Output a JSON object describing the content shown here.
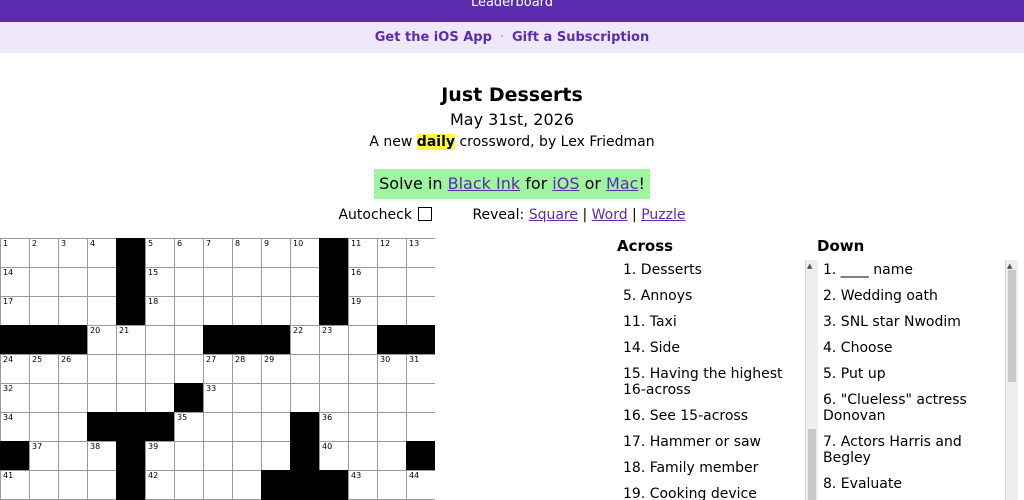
{
  "header": {
    "leaderboard": "Leaderboard"
  },
  "promo": {
    "ios_app": "Get the iOS App",
    "separator": "·",
    "gift": "Gift a Subscription"
  },
  "puzzle": {
    "title": "Just Desserts",
    "date": "May 31st, 2026",
    "byline_prefix": "A new ",
    "byline_highlight": "daily",
    "byline_suffix": " crossword, by Lex Friedman"
  },
  "solve": {
    "prefix": "Solve in ",
    "black_ink": "Black Ink",
    "for": " for ",
    "ios": "iOS",
    "or": " or ",
    "mac": "Mac",
    "suffix": "!"
  },
  "controls": {
    "autocheck": "Autocheck",
    "reveal": "Reveal:",
    "square": "Square",
    "word": "Word",
    "puzzle": "Puzzle",
    "sep": "|"
  },
  "grid": {
    "rows": [
      [
        "1",
        "2",
        "3",
        "4",
        "#",
        "5",
        "6",
        "7",
        "8",
        "9",
        "10",
        "#",
        "11",
        "12",
        "13"
      ],
      [
        "14",
        "",
        "",
        "",
        "#",
        "15",
        "",
        "",
        "",
        "",
        "",
        "#",
        "16",
        "",
        ""
      ],
      [
        "17",
        "",
        "",
        "",
        "#",
        "18",
        "",
        "",
        "",
        "",
        "",
        "#",
        "19",
        "",
        ""
      ],
      [
        "#",
        "#",
        "#",
        "20",
        "21",
        "",
        "",
        "#",
        "#",
        "#",
        "22",
        "23",
        "",
        "#",
        "#"
      ],
      [
        "24",
        "25",
        "26",
        "",
        "",
        "",
        "",
        "27",
        "28",
        "29",
        "",
        "",
        "",
        "30",
        "31"
      ],
      [
        "32",
        "",
        "",
        "",
        "",
        "",
        "#",
        "33",
        "",
        "",
        "",
        "",
        "",
        "",
        ""
      ],
      [
        "34",
        "",
        "",
        "#",
        "#",
        "#",
        "35",
        "",
        "",
        "",
        "#",
        "36",
        "",
        "",
        ""
      ],
      [
        "#",
        "37",
        "",
        "38",
        "#",
        "39",
        "",
        "",
        "",
        "",
        "#",
        "40",
        "",
        "",
        "#"
      ],
      [
        "41",
        "",
        "",
        "",
        "#",
        "42",
        "",
        "",
        "",
        "#",
        "#",
        "#",
        "43",
        "",
        "44"
      ]
    ]
  },
  "across": {
    "heading": "Across",
    "clues": [
      "1. Desserts",
      "5. Annoys",
      "11. Taxi",
      "14. Side",
      "15. Having the highest 16-across",
      "16. See 15-across",
      "17. Hammer or saw",
      "18. Family member",
      "19. Cooking device"
    ]
  },
  "down": {
    "heading": "Down",
    "clues": [
      "1. ____ name",
      "2. Wedding oath",
      "3. SNL star Nwodim",
      "4. Choose",
      "5. Put up",
      "6. \"Clueless\" actress Donovan",
      "7. Actors Harris and Begley",
      "8. Evaluate"
    ]
  },
  "colors": {
    "accent": "#5b2bb0",
    "promo_bg": "#efe8fb",
    "solve_bg": "#9ff59f",
    "highlight": "#ffff33"
  }
}
